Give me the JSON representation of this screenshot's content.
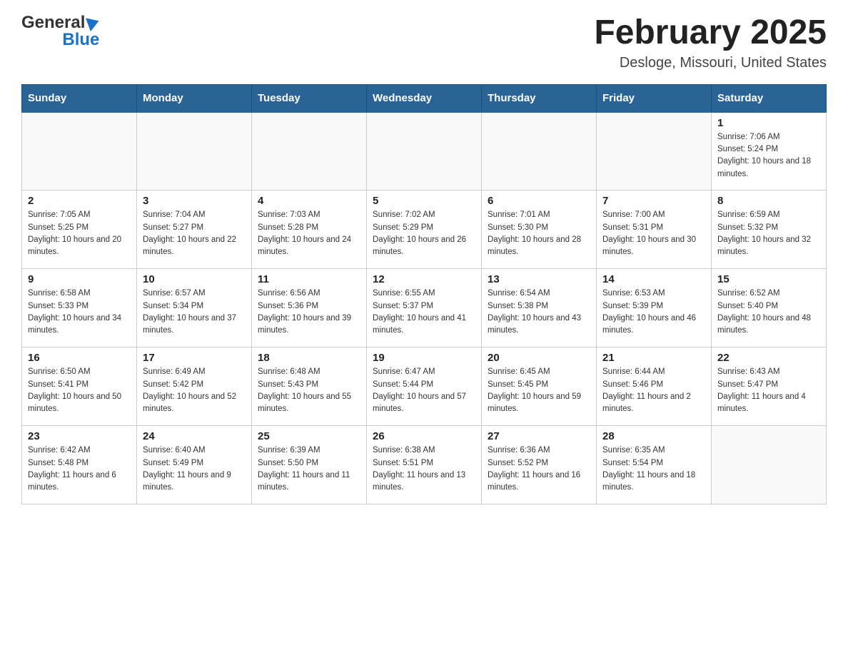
{
  "header": {
    "title": "February 2025",
    "subtitle": "Desloge, Missouri, United States",
    "logo_general": "General",
    "logo_blue": "Blue"
  },
  "calendar": {
    "days_of_week": [
      "Sunday",
      "Monday",
      "Tuesday",
      "Wednesday",
      "Thursday",
      "Friday",
      "Saturday"
    ],
    "weeks": [
      [
        {
          "day": "",
          "info": ""
        },
        {
          "day": "",
          "info": ""
        },
        {
          "day": "",
          "info": ""
        },
        {
          "day": "",
          "info": ""
        },
        {
          "day": "",
          "info": ""
        },
        {
          "day": "",
          "info": ""
        },
        {
          "day": "1",
          "info": "Sunrise: 7:06 AM\nSunset: 5:24 PM\nDaylight: 10 hours and 18 minutes."
        }
      ],
      [
        {
          "day": "2",
          "info": "Sunrise: 7:05 AM\nSunset: 5:25 PM\nDaylight: 10 hours and 20 minutes."
        },
        {
          "day": "3",
          "info": "Sunrise: 7:04 AM\nSunset: 5:27 PM\nDaylight: 10 hours and 22 minutes."
        },
        {
          "day": "4",
          "info": "Sunrise: 7:03 AM\nSunset: 5:28 PM\nDaylight: 10 hours and 24 minutes."
        },
        {
          "day": "5",
          "info": "Sunrise: 7:02 AM\nSunset: 5:29 PM\nDaylight: 10 hours and 26 minutes."
        },
        {
          "day": "6",
          "info": "Sunrise: 7:01 AM\nSunset: 5:30 PM\nDaylight: 10 hours and 28 minutes."
        },
        {
          "day": "7",
          "info": "Sunrise: 7:00 AM\nSunset: 5:31 PM\nDaylight: 10 hours and 30 minutes."
        },
        {
          "day": "8",
          "info": "Sunrise: 6:59 AM\nSunset: 5:32 PM\nDaylight: 10 hours and 32 minutes."
        }
      ],
      [
        {
          "day": "9",
          "info": "Sunrise: 6:58 AM\nSunset: 5:33 PM\nDaylight: 10 hours and 34 minutes."
        },
        {
          "day": "10",
          "info": "Sunrise: 6:57 AM\nSunset: 5:34 PM\nDaylight: 10 hours and 37 minutes."
        },
        {
          "day": "11",
          "info": "Sunrise: 6:56 AM\nSunset: 5:36 PM\nDaylight: 10 hours and 39 minutes."
        },
        {
          "day": "12",
          "info": "Sunrise: 6:55 AM\nSunset: 5:37 PM\nDaylight: 10 hours and 41 minutes."
        },
        {
          "day": "13",
          "info": "Sunrise: 6:54 AM\nSunset: 5:38 PM\nDaylight: 10 hours and 43 minutes."
        },
        {
          "day": "14",
          "info": "Sunrise: 6:53 AM\nSunset: 5:39 PM\nDaylight: 10 hours and 46 minutes."
        },
        {
          "day": "15",
          "info": "Sunrise: 6:52 AM\nSunset: 5:40 PM\nDaylight: 10 hours and 48 minutes."
        }
      ],
      [
        {
          "day": "16",
          "info": "Sunrise: 6:50 AM\nSunset: 5:41 PM\nDaylight: 10 hours and 50 minutes."
        },
        {
          "day": "17",
          "info": "Sunrise: 6:49 AM\nSunset: 5:42 PM\nDaylight: 10 hours and 52 minutes."
        },
        {
          "day": "18",
          "info": "Sunrise: 6:48 AM\nSunset: 5:43 PM\nDaylight: 10 hours and 55 minutes."
        },
        {
          "day": "19",
          "info": "Sunrise: 6:47 AM\nSunset: 5:44 PM\nDaylight: 10 hours and 57 minutes."
        },
        {
          "day": "20",
          "info": "Sunrise: 6:45 AM\nSunset: 5:45 PM\nDaylight: 10 hours and 59 minutes."
        },
        {
          "day": "21",
          "info": "Sunrise: 6:44 AM\nSunset: 5:46 PM\nDaylight: 11 hours and 2 minutes."
        },
        {
          "day": "22",
          "info": "Sunrise: 6:43 AM\nSunset: 5:47 PM\nDaylight: 11 hours and 4 minutes."
        }
      ],
      [
        {
          "day": "23",
          "info": "Sunrise: 6:42 AM\nSunset: 5:48 PM\nDaylight: 11 hours and 6 minutes."
        },
        {
          "day": "24",
          "info": "Sunrise: 6:40 AM\nSunset: 5:49 PM\nDaylight: 11 hours and 9 minutes."
        },
        {
          "day": "25",
          "info": "Sunrise: 6:39 AM\nSunset: 5:50 PM\nDaylight: 11 hours and 11 minutes."
        },
        {
          "day": "26",
          "info": "Sunrise: 6:38 AM\nSunset: 5:51 PM\nDaylight: 11 hours and 13 minutes."
        },
        {
          "day": "27",
          "info": "Sunrise: 6:36 AM\nSunset: 5:52 PM\nDaylight: 11 hours and 16 minutes."
        },
        {
          "day": "28",
          "info": "Sunrise: 6:35 AM\nSunset: 5:54 PM\nDaylight: 11 hours and 18 minutes."
        },
        {
          "day": "",
          "info": ""
        }
      ]
    ]
  }
}
